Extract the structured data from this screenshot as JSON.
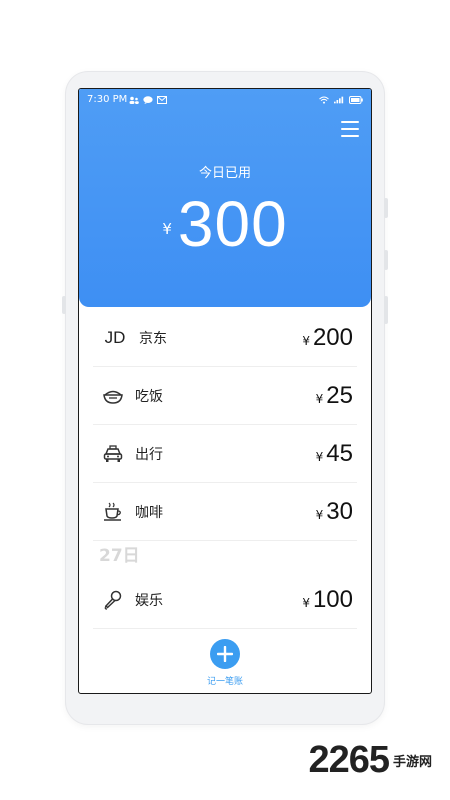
{
  "status_bar": {
    "time": "7:30 PM"
  },
  "header": {
    "today_label": "今日已用",
    "currency": "¥",
    "total": "300"
  },
  "expenses": [
    {
      "icon": "jd-logo-icon",
      "icon_text": "JD",
      "label": "京东",
      "currency": "¥",
      "amount": "200"
    },
    {
      "icon": "rice-bowl-icon",
      "label": "吃饭",
      "currency": "¥",
      "amount": "25"
    },
    {
      "icon": "taxi-icon",
      "label": "出行",
      "currency": "¥",
      "amount": "45"
    },
    {
      "icon": "coffee-cup-icon",
      "label": "咖啡",
      "currency": "¥",
      "amount": "30"
    }
  ],
  "date_group": {
    "date_label": "27日",
    "items": [
      {
        "icon": "microphone-icon",
        "label": "娱乐",
        "currency": "¥",
        "amount": "100"
      }
    ]
  },
  "add_button": {
    "label": "记一笔账"
  },
  "watermark": {
    "number": "2265",
    "suffix": "手游网"
  },
  "colors": {
    "header_blue": "#4596f4",
    "accent_blue": "#3b9df1",
    "watermark_orange": "#f0a000"
  }
}
